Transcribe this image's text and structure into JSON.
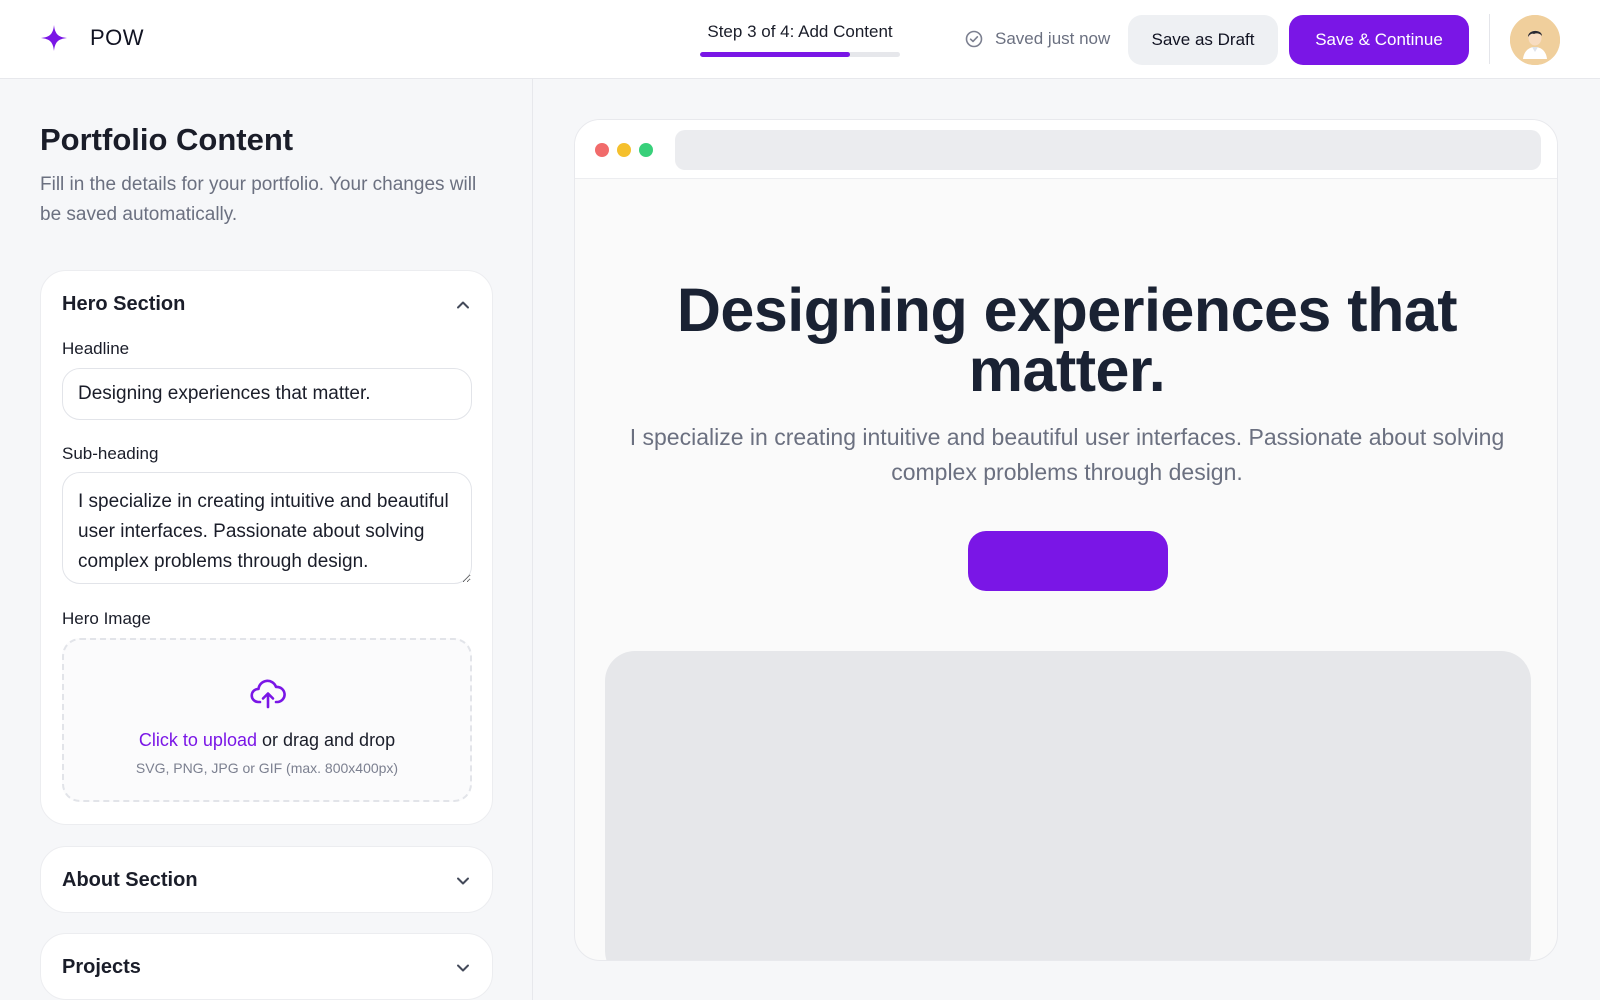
{
  "header": {
    "logo_text": "POW",
    "step_label": "Step 3 of 4: Add Content",
    "step_progress": 0.75,
    "saved_status": "Saved just now",
    "save_draft_label": "Save as Draft",
    "save_continue_label": "Save & Continue",
    "avatar_icon": "user-avatar"
  },
  "sidebar": {
    "title": "Portfolio Content",
    "description": "Fill in the details for your portfolio. Your changes will be saved automatically.",
    "hero": {
      "title": "Hero Section",
      "expanded": true,
      "headline_label": "Headline",
      "headline_value": "Designing experiences that matter.",
      "subheading_label": "Sub-heading",
      "subheading_value": "I specialize in creating intuitive and beautiful user interfaces. Passionate about solving complex problems through design.",
      "image_label": "Hero Image",
      "upload_link": "Click to upload",
      "upload_text": " or drag and drop",
      "upload_hint": "SVG, PNG, JPG or GIF (max. 800x400px)"
    },
    "about": {
      "title": "About Section",
      "expanded": false
    },
    "projects": {
      "title": "Projects",
      "expanded": false
    }
  },
  "preview": {
    "headline": "Designing experiences that matter.",
    "subheading": "I specialize in creating intuitive and beautiful user interfaces. Passionate about solving complex problems through design.",
    "cta_label": ""
  },
  "colors": {
    "accent": "#7a16e6",
    "text_primary": "#1a1d29",
    "text_muted": "#6b7080",
    "traffic_red": "#f16b6b",
    "traffic_yellow": "#f5c02d",
    "traffic_green": "#38d07a"
  }
}
